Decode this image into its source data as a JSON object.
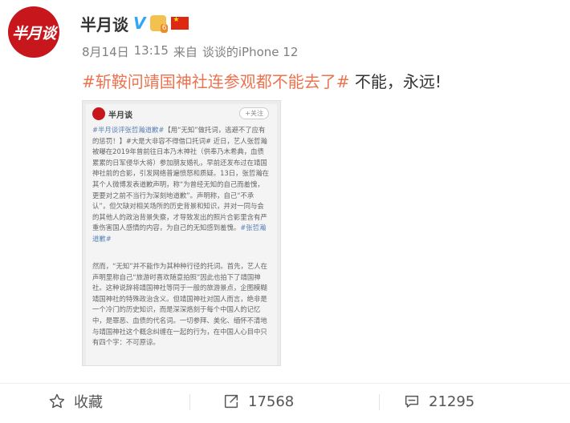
{
  "account": {
    "avatar_text": "半月谈",
    "name": "半月谈",
    "verified_mark": "V"
  },
  "meta": {
    "date": "8月14日",
    "time": "13:15",
    "source_prefix": "来自",
    "source": "谈谈的iPhone 12"
  },
  "post": {
    "hashtag": "#斩鞍问靖国神社连参观都不能去了#",
    "text": " 不能，永远!"
  },
  "embedded": {
    "name": "半月谈",
    "follow": "+关注",
    "para1_tag": "#半月谈评张哲瀚道歉#",
    "para1": "【用“无知”做托词，逃避不了应有的惩罚！】#大是大非容不得借口托词# 近日，艺人张哲瀚被曝在2019年曾前往日本乃木神社（供奉乃木希典，血债累累的日军侵华大将）参加朋友婚礼，早前还发布过在靖国神社前的合影，引发网络普遍愤怒和质疑。13日，张哲瀚在其个人微博发表道歉声明，称“为曾经无知的自己而羞愧，更要对之前不当行为深刻地道歉”。声明称，自己“不承认”，但欠缺对相关场所的历史背景和知识，并对一同与会的其他人的政治背景失察，才导致发出的照片合影里含有严重伤害国人感情的内容，为自己的无知感到羞愧。",
    "para1_end_tag": "#张哲瀚道歉#",
    "para2": "然而，“无知”并不能作为其种种行径的托词。首先，艺人在声明里称自己“旅游时喜欢随意拍照”因此也拍下了靖国神社。这种说辞将靖国神社等同于一般的旅游景点，企图模糊靖国神社的特殊政治含义。但靖国神社对国人而言，绝非是一个冷门的历史知识，而是深深烙刻于每个中国人的记忆中，是罪恶、血债的代名词。一切参拜、美化、缅怀不清地与靖国神社这个概念纠缠在一起的行为，在中国人心目中只有四个字：不可原谅。"
  },
  "actions": {
    "favorite_label": "收藏",
    "repost_count": "17568",
    "comment_count": "21295"
  },
  "icons": [
    "star-icon",
    "share-icon",
    "comment-icon",
    "badge-icon",
    "flag-icon"
  ],
  "colors": {
    "brand_red": "#c8161d",
    "hashtag": "#eb7350",
    "verified": "#33a7f3",
    "meta_gray": "#808080"
  }
}
